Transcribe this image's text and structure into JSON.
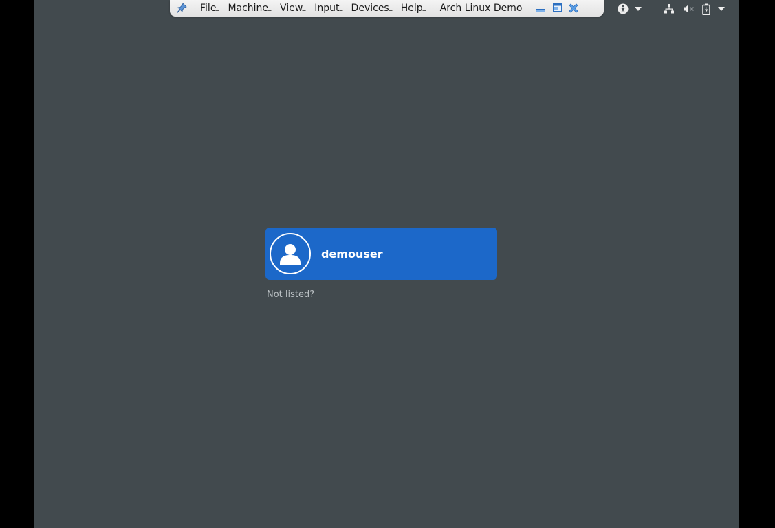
{
  "vbox_toolbar": {
    "menus": [
      {
        "label": "File"
      },
      {
        "label": "Machine"
      },
      {
        "label": "View"
      },
      {
        "label": "Input"
      },
      {
        "label": "Devices"
      },
      {
        "label": "Help"
      }
    ],
    "vm_title": "Arch Linux Demo",
    "icons": {
      "pin": "pin-icon",
      "minimize": "minimize-icon",
      "restore": "restore-icon",
      "close": "close-icon"
    }
  },
  "top_bar": {
    "accessibility_icon": "accessibility-icon",
    "network_icon": "network-wired-icon",
    "volume_icon": "volume-muted-icon",
    "battery_icon": "battery-charging-icon"
  },
  "login": {
    "username": "demouser",
    "not_listed": "Not listed?"
  },
  "colors": {
    "background": "#424a4e",
    "user_card": "#1c68c9",
    "toolbar": "#eeeeee",
    "accent_blue": "#2a7bd4"
  }
}
